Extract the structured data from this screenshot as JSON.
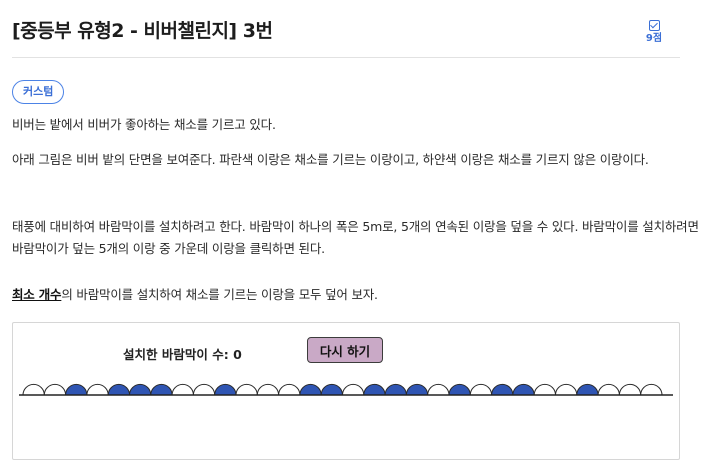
{
  "header": {
    "title": "[중등부 유형2 - 비버챌린지] 3번",
    "points": "9점"
  },
  "badge": "커스텀",
  "paragraphs": {
    "p1": "비버는 밭에서 비버가 좋아하는 채소를 기르고 있다.",
    "p2": "아래 그림은 비버 밭의 단면을 보여준다. 파란색 이랑은 채소를 기르는 이랑이고, 하얀색 이랑은 채소를 기르지 않은 이랑이다.",
    "p3": "태풍에 대비하여 바람막이를 설치하려고 한다. 바람막이 하나의 폭은 5m로, 5개의 연속된 이랑을 덮을 수 있다. 바람막이를 설치하려면 바람막이가 덮는 5개의 이랑 중 가운데 이랑을 클릭하면 된다.",
    "p4_emph": "최소 개수",
    "p4_rest": "의 바람막이를 설치하여 채소를 기르는 이랑을 모두 덮어 보자."
  },
  "panel": {
    "counter_label": "설치한 바람막이 수: ",
    "counter_value": "0",
    "reset_label": "다시 하기",
    "ridges": [
      "white",
      "white",
      "blue",
      "white",
      "blue",
      "blue",
      "blue",
      "white",
      "white",
      "blue",
      "white",
      "white",
      "white",
      "blue",
      "blue",
      "white",
      "blue",
      "blue",
      "blue",
      "white",
      "blue",
      "white",
      "blue",
      "blue",
      "white",
      "white",
      "blue",
      "white",
      "white",
      "white"
    ],
    "colors": {
      "blue": "#2f55b3",
      "white": "#ffffff",
      "stroke": "#2a2a2a"
    }
  }
}
